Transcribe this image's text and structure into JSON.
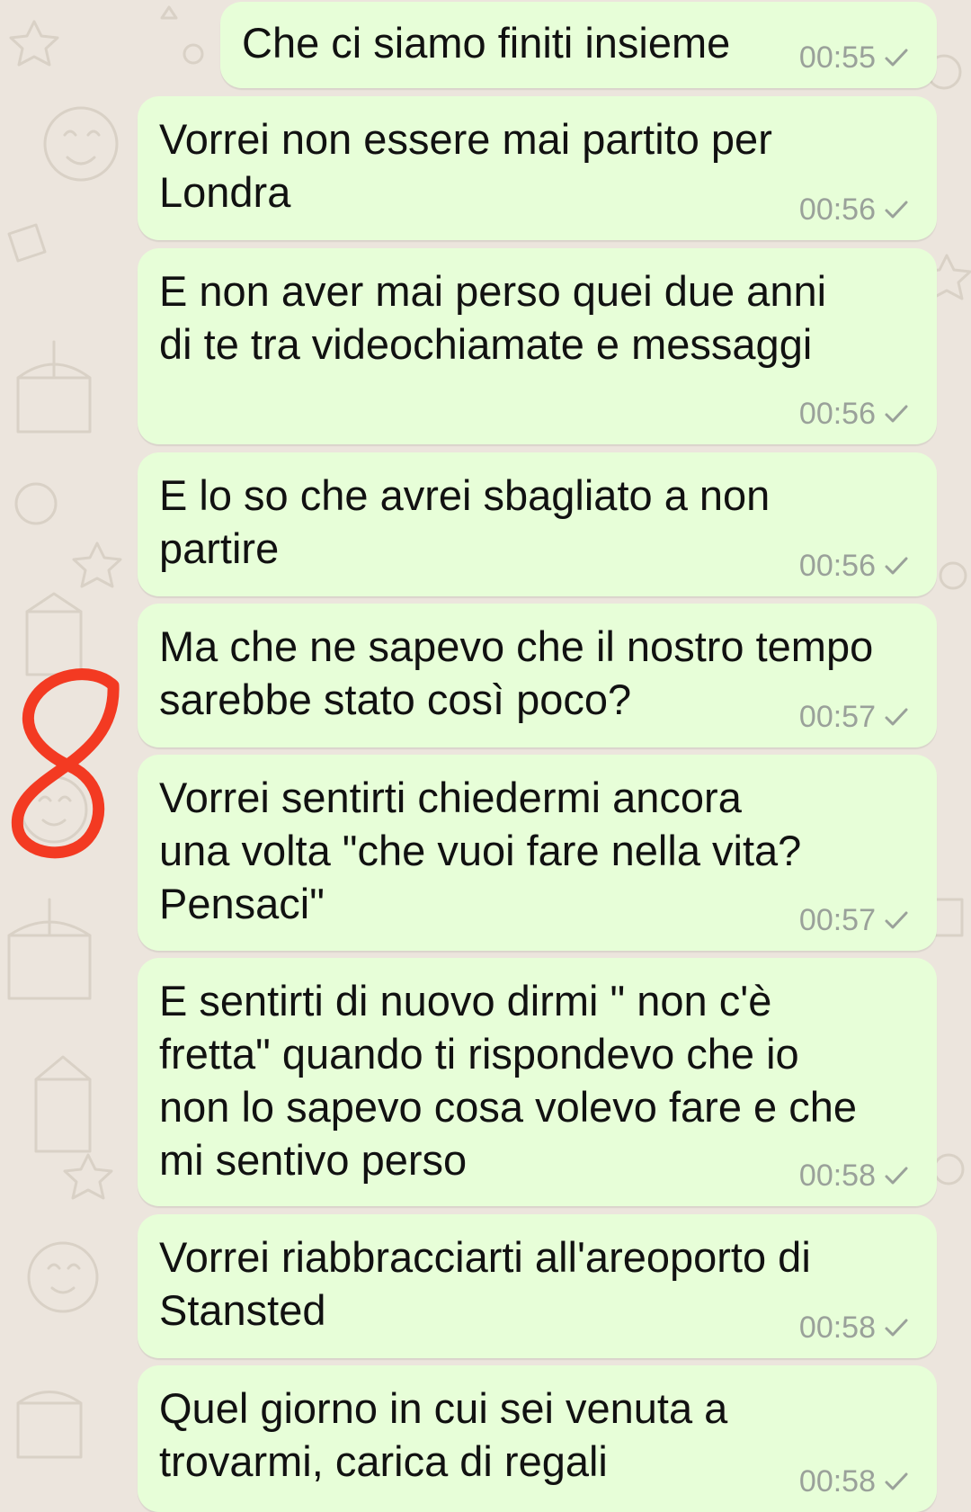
{
  "colors": {
    "background": "#ece5dd",
    "bubble": "#e7fed8",
    "text": "#111111",
    "meta": "#9aa19a",
    "annotation": "#f33a22"
  },
  "icons": {
    "tick": "single-check-icon",
    "annotation": "handwritten-number-8"
  },
  "messages": [
    {
      "text": "Che ci siamo finiti insieme",
      "time": "00:55",
      "status": "sent"
    },
    {
      "text": "Vorrei non essere mai partito per\nLondra",
      "time": "00:56",
      "status": "sent"
    },
    {
      "text": "E non aver mai perso quei due anni\ndi te tra videochiamate e messaggi",
      "time": "00:56",
      "status": "sent"
    },
    {
      "text": "E lo so che avrei sbagliato a non\npartire",
      "time": "00:56",
      "status": "sent"
    },
    {
      "text": "Ma che ne sapevo che il nostro tempo\nsarebbe stato così poco?",
      "time": "00:57",
      "status": "sent"
    },
    {
      "text": "Vorrei sentirti chiedermi ancora\nuna volta \"che vuoi fare nella vita?\nPensaci\"",
      "time": "00:57",
      "status": "sent"
    },
    {
      "text": "E sentirti di nuovo dirmi \" non c'è\nfretta\" quando ti rispondevo che io\nnon lo sapevo cosa volevo fare e che\nmi sentivo perso",
      "time": "00:58",
      "status": "sent"
    },
    {
      "text": "Vorrei riabbracciarti all'areoporto di\nStansted",
      "time": "00:58",
      "status": "sent"
    },
    {
      "text": "Quel giorno in cui sei venuta a\ntrovarmi, carica di regali",
      "time": "00:58",
      "status": "sent"
    }
  ]
}
